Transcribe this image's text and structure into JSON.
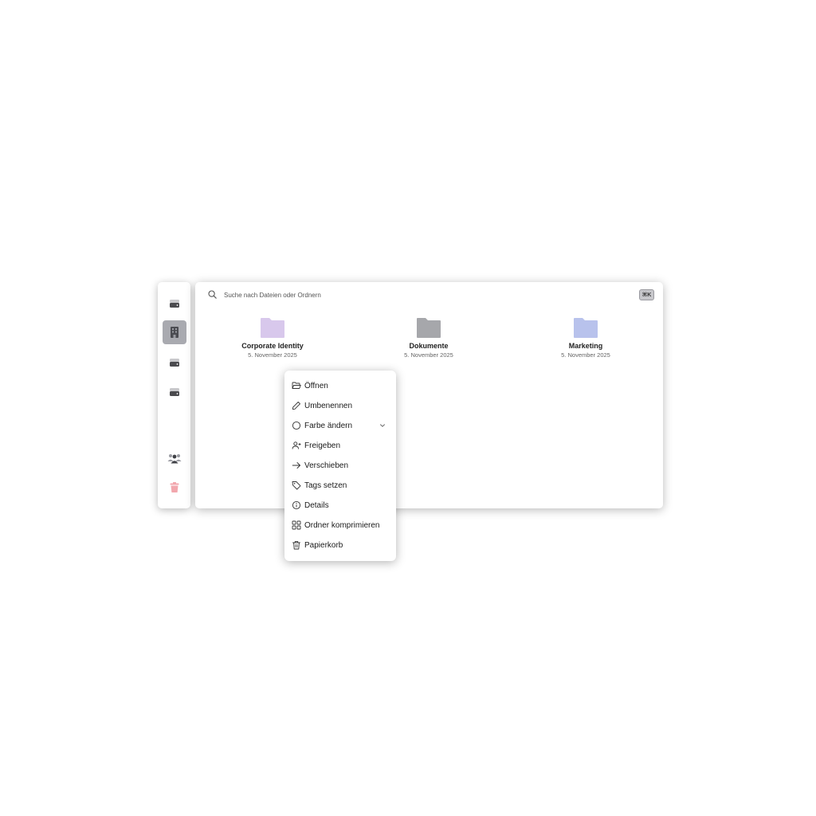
{
  "sidebar": {
    "items": [
      {
        "icon": "drive-icon"
      },
      {
        "icon": "building-icon",
        "active": true
      },
      {
        "icon": "drive-icon"
      },
      {
        "icon": "drive-icon"
      },
      {
        "icon": "users-icon"
      },
      {
        "icon": "trash-icon"
      }
    ]
  },
  "search": {
    "placeholder": "Suche nach Dateien oder Ordnern",
    "shortcut": "⌘K"
  },
  "folders": [
    {
      "name": "Corporate Identity",
      "date": "5. November 2025",
      "color": "#d8c8ec"
    },
    {
      "name": "Dokumente",
      "date": "5. November 2025",
      "color": "#a6a7ab"
    },
    {
      "name": "Marketing",
      "date": "5. November 2025",
      "color": "#b8c2ec"
    }
  ],
  "context_menu": {
    "items": [
      {
        "label": "Öffnen",
        "icon": "folder-open-icon"
      },
      {
        "label": "Umbenennen",
        "icon": "pencil-icon"
      },
      {
        "label": "Farbe ändern",
        "icon": "circle-icon",
        "has_submenu": true
      },
      {
        "label": "Freigeben",
        "icon": "user-plus-icon"
      },
      {
        "label": "Verschieben",
        "icon": "arrow-right-icon"
      },
      {
        "label": "Tags setzen",
        "icon": "tag-icon"
      },
      {
        "label": "Details",
        "icon": "info-icon"
      },
      {
        "label": "Ordner komprimieren",
        "icon": "grid-icon"
      },
      {
        "label": "Papierkorb",
        "icon": "trash-icon"
      }
    ]
  }
}
